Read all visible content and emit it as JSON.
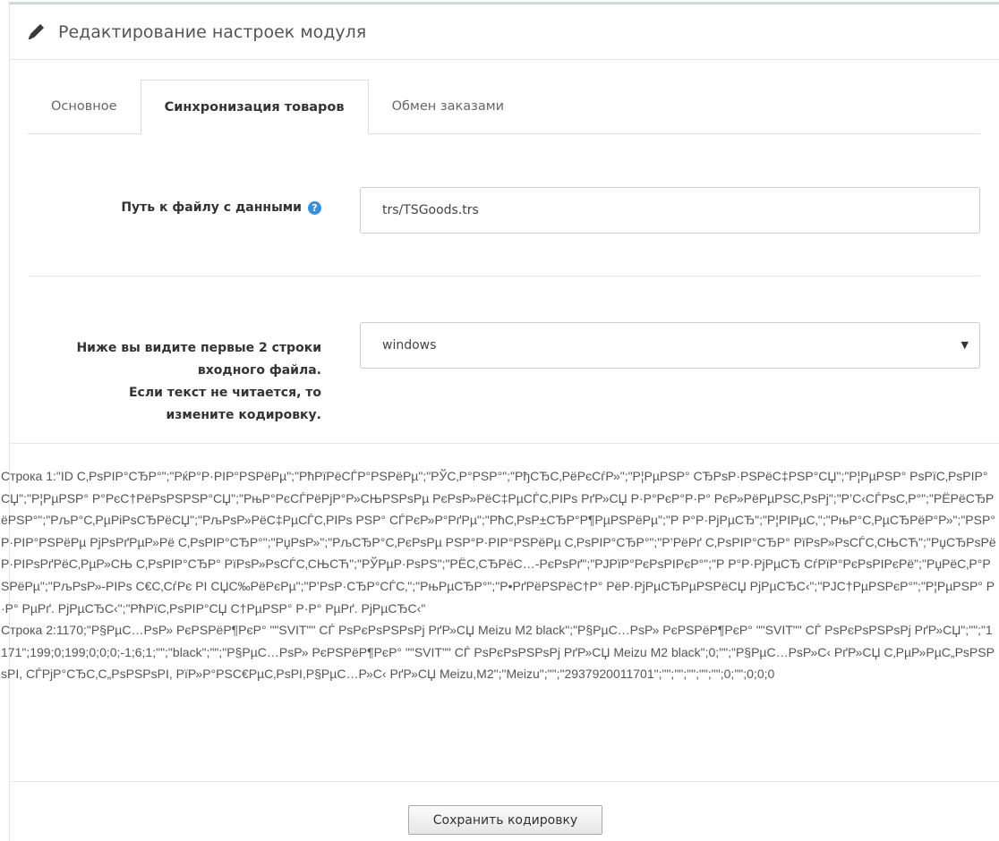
{
  "header": {
    "title": "Редактирование настроек модуля",
    "icon": "pencil-icon"
  },
  "tabs": [
    {
      "label": "Основное",
      "active": false
    },
    {
      "label": "Синхронизация товаров",
      "active": true
    },
    {
      "label": "Обмен заказами",
      "active": false
    }
  ],
  "path_field": {
    "label": "Путь к файлу с данными",
    "help_icon": "?",
    "value": "trs/TSGoods.trs"
  },
  "encoding_field": {
    "label_line1": "Ниже вы видите первые 2 строки",
    "label_line2": "входного файла.",
    "label_line3": "Если текст не читается, то",
    "label_line4": "измените кодировку.",
    "selected": "windows",
    "arrow": "▼"
  },
  "file_preview": {
    "line1": "Строка 1:\"ID С‚РѕРІР°СЂР°\";\"РќР°Р·РІР°РЅРёРµ\";\"РћРїРёСЃР°РЅРёРµ\";\"РЎС‚Р°РЅР°\";\"РђСЂС‚РёРєСѓР»\";\"Р¦РµРЅР° СЂРѕР·РЅРёС‡РЅР°СЏ\";\"Р¦РµРЅР° РѕРїС‚РѕРІР°СЏ\";\"Р¦РµРЅР° Р°РєС†РёРѕРЅРЅР°СЏ\";\"РњР°РєСЃРёРјР°Р»СЊРЅРѕРµ РєРѕР»РёС‡РµСЃС‚РІРѕ РґР»СЏ Р·Р°РєР°Р·Р° РєР»РёРµРЅС‚РѕРј\";\"Р’С‹СЃРѕС‚Р°\";\"РЁРёСЂРёРЅР°\";\"РљР°С‚РµРіРѕСЂРёСЏ\";\"РљРѕР»РёС‡РµСЃС‚РІРѕ РЅР° СЃРєР»Р°РґРµ\";\"РћС‚РѕР±СЂР°Р¶РµРЅРёРµ\";\"Р Р°Р·РјРµСЂ\";\"Р¦РІРµС‚\";\"РњР°С‚РµСЂРёР°Р»\";\"РЅР°Р·РІР°РЅРёРµ РјРѕРґРµР»Рё С‚РѕРІР°СЂР°\";\"РџРѕР»\";\"РљСЂР°С‚РєРѕРµ РЅР°Р·РІР°РЅРёРµ С‚РѕРІР°СЂР°\";\"Р’РёРґ С‚РѕРІР°СЂР° РїРѕР»РѕСЃС‚СЊСЋ\";\"РџСЂРѕРёР·РІРѕРґРёС‚РµР»СЊ С‚РѕРІР°СЂР° РїРѕР»РѕСЃС‚СЊСЋ\";\"РЎРµР·РѕРЅ\";\"РЁС‚СЂРёС…-РєРѕРґ\";\"РЈРїР°РєРѕРІРєР°\";\"Р Р°Р·РјРµСЂ СѓРїР°РєРѕРІРєРё\";\"РџРёС‚Р°РЅРёРµ\";\"РљРѕР»-РІРѕ С€С‚СѓРє РІ СЏС‰РёРєРµ\";\"Р’РѕР·СЂР°СЃС‚\";\"РњРµСЂР°\";\"Р•РґРёРЅРёС†Р° РёР·РјРµСЂРµРЅРёСЏ РјРµСЂС‹\";\"РЈС†РµРЅРєР°\";\"Р¦РµРЅР° Р·Р° РµРґ. РјРµСЂС‹\";\"РћРїС‚РѕРІР°СЏ С†РµРЅР° Р·Р° РµРґ. РјРµСЂС‹\"",
    "line2": "Строка 2:1170;\"Р§РµС…РѕР» РєРЅРёР¶РєР° \"\"SVIT\"\" СЃ РѕРєРѕРЅРѕРј РґР»СЏ Meizu M2 black\";\"Р§РµС…РѕР» РєРЅРёР¶РєР° \"\"SVIT\"\" СЃ РѕРєРѕРЅРѕРј РґР»СЏ\";\"\";\"1171\";199;0;199;0;0;0;-1;6;1;\"\";\"black\";\"\";\"Р§РµС…РѕР» РєРЅРёР¶РєР° \"\"SVIT\"\" СЃ РѕРєРѕРЅРѕРј РґР»СЏ Meizu M2 black\";0;\"\";\"Р§РµС…РѕР»С‹ РґР»СЏ С‚РµР»РµС„РѕРЅРѕРІ, СЃРјР°СЂС‚С„РѕРЅРѕРІ, РїР»Р°РЅС€РµС‚РѕРІ,Р§РµС…Р»С‹ РґР»СЏ Meizu,M2\";\"Meizu\";\"\";\"2937920011701\";\"\";\"\";\"\";\"\";\"\";0;\"\";0;0;0"
  },
  "footer": {
    "save_label": "Сохранить кодировку"
  }
}
